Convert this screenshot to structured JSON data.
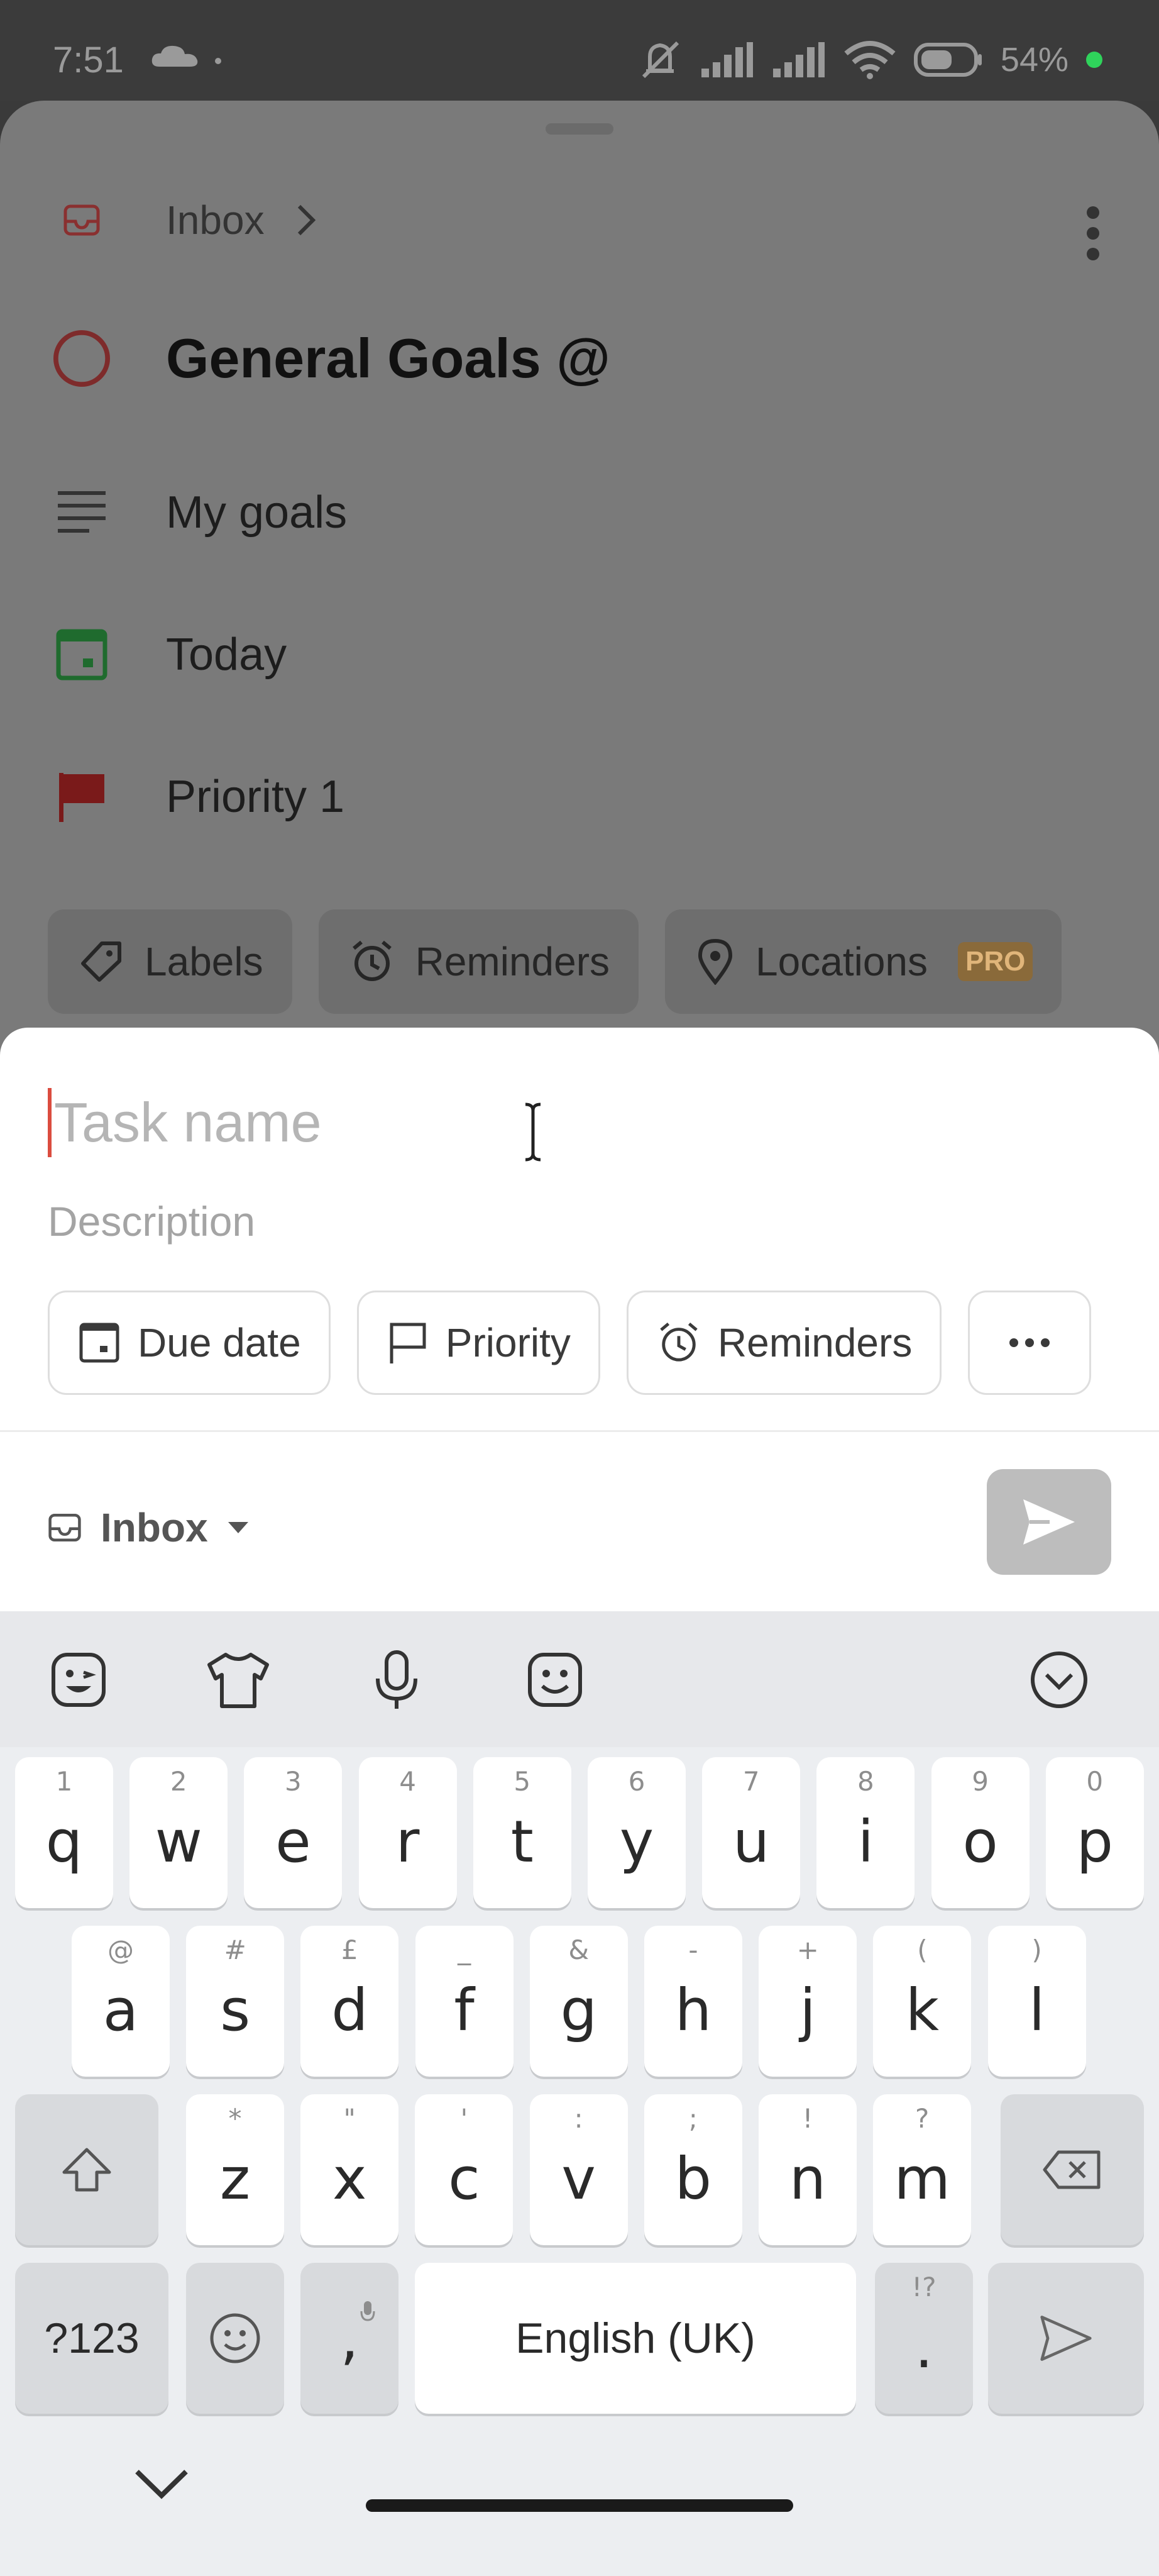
{
  "status_bar": {
    "time": "7:51",
    "battery": "54%",
    "icons": [
      "cloud-icon",
      "mute-icon",
      "signal-icon",
      "signal-icon",
      "wifi-icon",
      "battery-icon"
    ]
  },
  "detail_sheet": {
    "breadcrumb": "Inbox",
    "task_title": "General Goals @",
    "description": "My goals",
    "due": "Today",
    "priority": "Priority 1",
    "chips": {
      "labels": "Labels",
      "reminders": "Reminders",
      "locations": "Locations",
      "pro_badge": "PRO"
    },
    "colors": {
      "priority_flag": "#7a1a1a",
      "date_icon": "#1f6b2e",
      "circle": "#7e2b2b"
    }
  },
  "quick_add": {
    "task_name_placeholder": "Task name",
    "description_placeholder": "Description",
    "chips": {
      "due_date": "Due date",
      "priority": "Priority",
      "reminders": "Reminders"
    },
    "project": "Inbox",
    "colors": {
      "caret": "#db4c3f",
      "send_button": "#bdbdbd"
    }
  },
  "keyboard": {
    "toolbar_icons": [
      "sticker-icon",
      "clothing-icon",
      "microphone-icon",
      "emoji-icon",
      "collapse-icon"
    ],
    "row1": [
      {
        "k": "q",
        "h": "1"
      },
      {
        "k": "w",
        "h": "2"
      },
      {
        "k": "e",
        "h": "3"
      },
      {
        "k": "r",
        "h": "4"
      },
      {
        "k": "t",
        "h": "5"
      },
      {
        "k": "y",
        "h": "6"
      },
      {
        "k": "u",
        "h": "7"
      },
      {
        "k": "i",
        "h": "8"
      },
      {
        "k": "o",
        "h": "9"
      },
      {
        "k": "p",
        "h": "0"
      }
    ],
    "row2": [
      {
        "k": "a",
        "h": "@"
      },
      {
        "k": "s",
        "h": "#"
      },
      {
        "k": "d",
        "h": "£"
      },
      {
        "k": "f",
        "h": "_"
      },
      {
        "k": "g",
        "h": "&"
      },
      {
        "k": "h",
        "h": "-"
      },
      {
        "k": "j",
        "h": "+"
      },
      {
        "k": "k",
        "h": "("
      },
      {
        "k": "l",
        "h": ")"
      }
    ],
    "row3": [
      {
        "k": "z",
        "h": "*"
      },
      {
        "k": "x",
        "h": "\""
      },
      {
        "k": "c",
        "h": "'"
      },
      {
        "k": "v",
        "h": ":"
      },
      {
        "k": "b",
        "h": ";"
      },
      {
        "k": "n",
        "h": "!"
      },
      {
        "k": "m",
        "h": "?"
      }
    ],
    "symbols_key": "?123",
    "comma_key": ",",
    "space_key": "English (UK)",
    "period_key": ".",
    "period_hint": "!?"
  }
}
